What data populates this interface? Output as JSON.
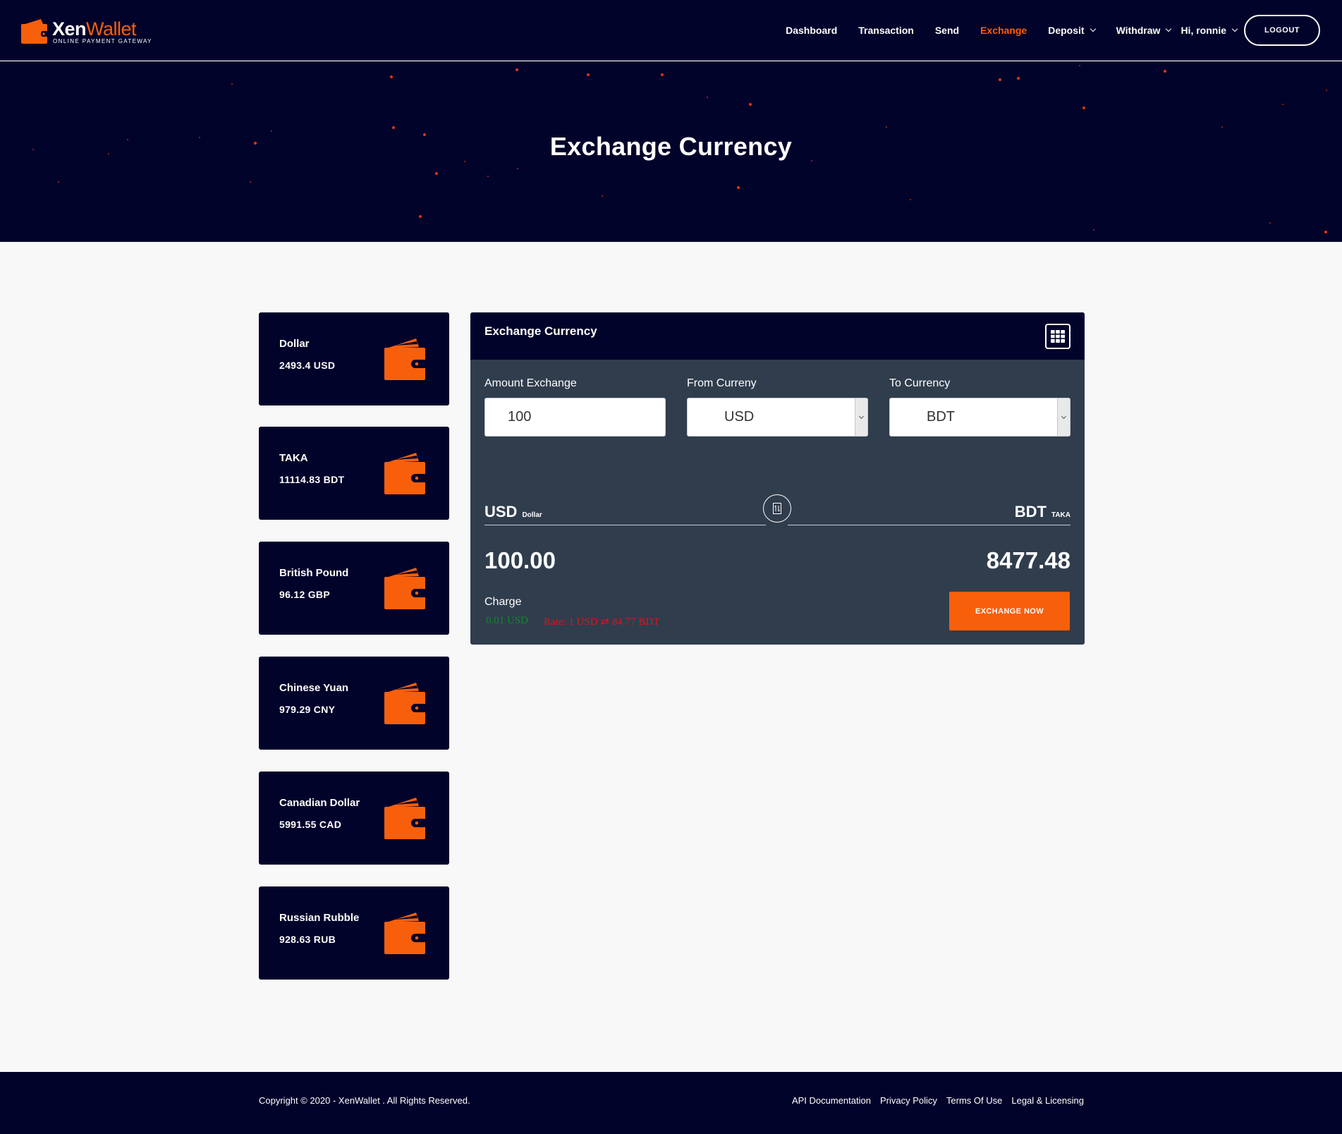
{
  "brand": {
    "name_main": "Xen",
    "name_accent": "Wallet",
    "tagline": "ONLINE PAYMENT GATEWAY",
    "accent_color": "#f85f0b",
    "navy_color": "#02032a"
  },
  "nav": {
    "items": [
      {
        "label": "Dashboard",
        "active": false,
        "dropdown": false
      },
      {
        "label": "Transaction",
        "active": false,
        "dropdown": false
      },
      {
        "label": "Send",
        "active": false,
        "dropdown": false
      },
      {
        "label": "Exchange",
        "active": true,
        "dropdown": false
      },
      {
        "label": "Deposit",
        "active": false,
        "dropdown": true
      },
      {
        "label": "Withdraw",
        "active": false,
        "dropdown": true
      }
    ],
    "greeting": "Hi, ronnie",
    "logout_label": "LOGOUT"
  },
  "hero": {
    "title": "Exchange Currency"
  },
  "wallets": [
    {
      "name": "Dollar",
      "balance": "2493.4 USD",
      "icon": "wallet-icon"
    },
    {
      "name": "TAKA",
      "balance": "11114.83 BDT",
      "icon": "wallet-icon"
    },
    {
      "name": "British Pound",
      "balance": "96.12 GBP",
      "icon": "wallet-icon"
    },
    {
      "name": "Chinese Yuan",
      "balance": "979.29 CNY",
      "icon": "wallet-icon"
    },
    {
      "name": "Canadian Dollar",
      "balance": "5991.55 CAD",
      "icon": "wallet-icon"
    },
    {
      "name": "Russian Rubble",
      "balance": "928.63 RUB",
      "icon": "wallet-icon"
    }
  ],
  "exchange": {
    "title": "Exchange Currency",
    "header_icon": "grid-icon",
    "amount_label": "Amount Exchange",
    "amount_value": "100",
    "from_label": "From Curreny",
    "from_value": "USD",
    "to_label": "To Currency",
    "to_value": "BDT",
    "from_code": "USD",
    "from_name": "Dollar",
    "to_code": "BDT",
    "to_name": "TAKA",
    "swap_icon": "swap-icon",
    "from_amount": "100.00",
    "to_amount": "8477.48",
    "charge_label": "Charge",
    "charge_value": "0.01 USD",
    "rate_text": "Rate: 1 USD ⇄ 84.77 BDT",
    "button_label": "EXCHANGE NOW"
  },
  "footer": {
    "copyright": "Copyright © 2020 - XenWallet . All Rights Reserved.",
    "links": [
      "API Documentation",
      "Privacy Policy",
      "Terms Of Use",
      "Legal & Licensing"
    ]
  }
}
